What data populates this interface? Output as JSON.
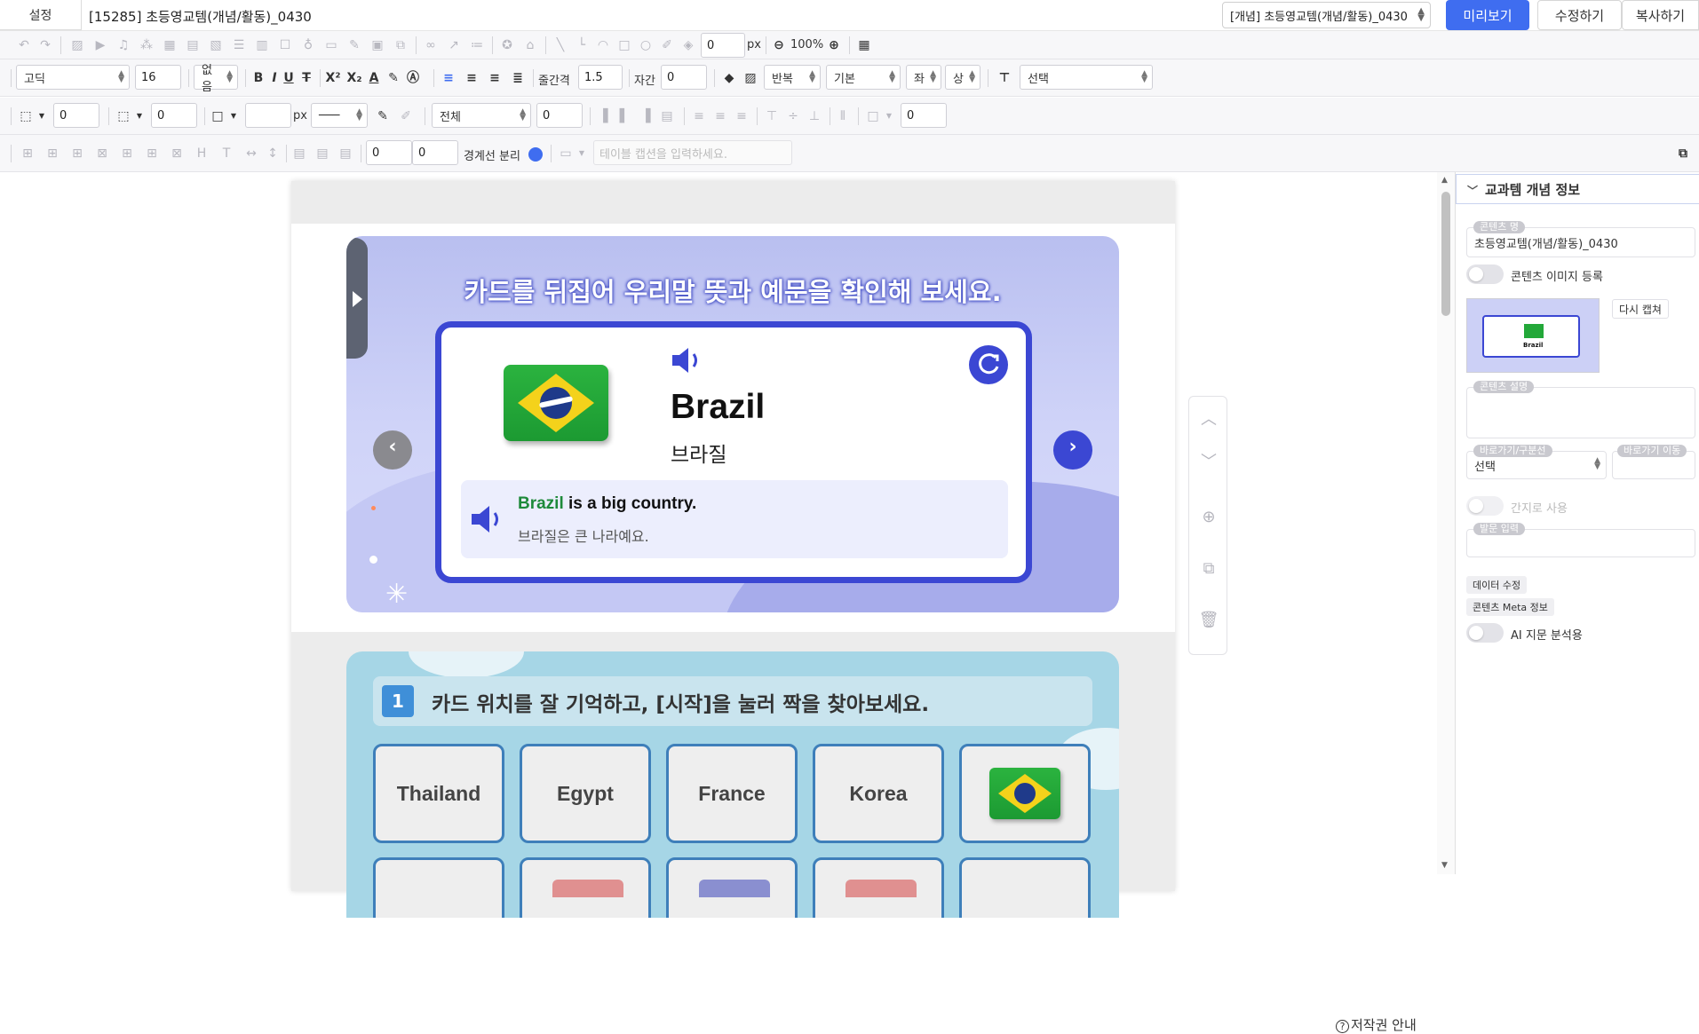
{
  "topbar": {
    "settings_label": "설정",
    "doc_title": "[15285] 초등영교템(개념/활동)_0430",
    "page_select_value": "[개념] 초등영교템(개념/활동)_0430",
    "preview_label": "미리보기",
    "edit_label": "수정하기",
    "copy_label": "복사하기"
  },
  "toolbar1": {
    "px_value": "0",
    "px_unit": "px",
    "zoom": "100%"
  },
  "toolbar2": {
    "font_family": "고딕",
    "font_size": "16",
    "style_none": "없음",
    "line_spacing_label": "줄간격",
    "line_spacing_value": "1.5",
    "letter_spacing_label": "자간",
    "letter_spacing_value": "0",
    "repeat_label": "반복",
    "basic_label": "기본",
    "left_label": "좌",
    "top_label": "상",
    "select_label": "선택"
  },
  "toolbar3": {
    "border_value1": "0",
    "border_value2": "0",
    "px_unit": "px",
    "scope": "전체",
    "scope_value": "0",
    "last_value": "0"
  },
  "toolbar4": {
    "value1": "0",
    "value2": "0",
    "border_split_label": "경계선 분리",
    "caption_placeholder": "테이블 캡션을 입력하세요."
  },
  "card": {
    "heading": "카드를 뒤집어 우리말 뜻과 예문을 확인해 보세요.",
    "word_en": "Brazil",
    "word_ko": "브라질",
    "example_highlight": "Brazil",
    "example_rest": " is a big country.",
    "example_ko": "브라질은 큰 나라예요."
  },
  "game": {
    "number": "1",
    "title": "카드 위치를 잘 기억하고, [시작]을 눌러 짝을 찾아보세요.",
    "tiles": [
      "Thailand",
      "Egypt",
      "France",
      "Korea"
    ]
  },
  "copyright": "저작권 안내",
  "panel": {
    "title": "교과템 개념 정보",
    "content_name_label": "콘텐츠 명",
    "content_name_value": "초등영교템(개념/활동)_0430",
    "image_register_label": "콘텐츠 이미지 등록",
    "thumb_word": "Brazil",
    "recapture_label": "다시 캡쳐",
    "description_label": "콘텐츠 설명",
    "shortcut_label": "바로가기/구분선",
    "shortcut_value": "선택",
    "shortcut_move_label": "바로가기 이동",
    "spacer_label": "간지로 사용",
    "question_label": "발문 입력",
    "data_edit_label": "데이터 수정",
    "meta_label": "콘텐츠 Meta 정보",
    "ai_label": "AI 지문 분석용"
  },
  "colors": {
    "primary": "#3f6df0",
    "card_border": "#3b47d3",
    "highlight_green": "#1e8a3a",
    "game_bg": "#a6d6e6"
  }
}
